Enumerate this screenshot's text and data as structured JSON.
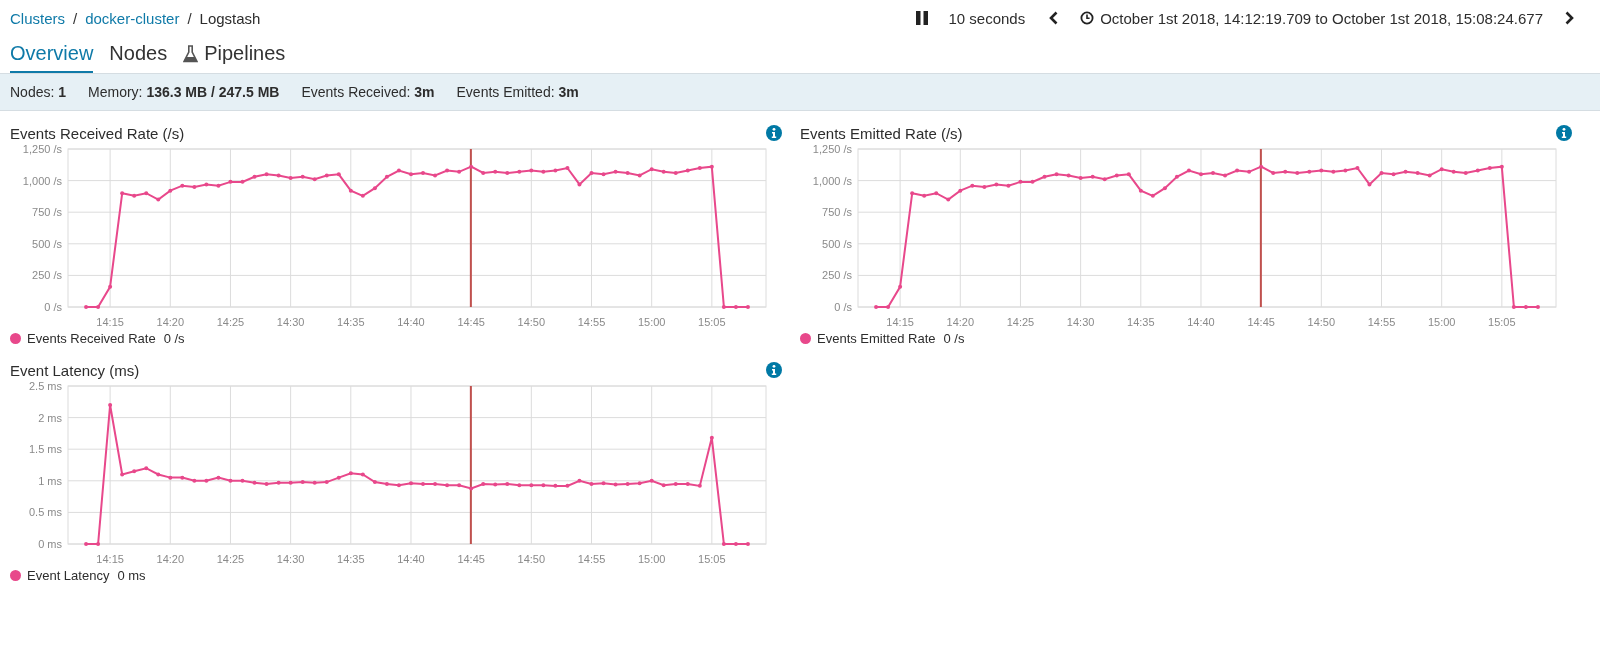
{
  "breadcrumbs": [
    {
      "label": "Clusters",
      "link": true
    },
    {
      "label": "docker-cluster",
      "link": true
    },
    {
      "label": "Logstash",
      "link": false
    }
  ],
  "breadcrumb_separator": "/",
  "time_controls": {
    "interval": "10 seconds",
    "range": "October 1st 2018, 14:12:19.709 to October 1st 2018, 15:08:24.677"
  },
  "tabs": [
    {
      "label": "Overview",
      "selected": true,
      "icon": false
    },
    {
      "label": "Nodes",
      "selected": false,
      "icon": false
    },
    {
      "label": "Pipelines",
      "selected": false,
      "icon": true
    }
  ],
  "stats": [
    "Nodes: **1**",
    "Memory: **136.3 MB / 247.5 MB**",
    "Events Received: **3m**",
    "Events Emitted: **3m**"
  ],
  "charts": [
    {
      "legend_value": "0 /s",
      "chart_data": {
        "type": "line",
        "title": "Events Received Rate (/s)",
        "grid": true,
        "ylim": [
          0,
          1250
        ],
        "yticks": [
          {
            "value": 0,
            "label": "0 /s"
          },
          {
            "value": 250,
            "label": "250 /s"
          },
          {
            "value": 500,
            "label": "500 /s"
          },
          {
            "value": 750,
            "label": "750 /s"
          },
          {
            "value": 1000,
            "label": "1,000 /s"
          },
          {
            "value": 1250,
            "label": "1,250 /s"
          }
        ],
        "categories": [
          null,
          null,
          "14:15",
          null,
          null,
          null,
          null,
          "14:20",
          null,
          null,
          null,
          null,
          "14:25",
          null,
          null,
          null,
          null,
          "14:30",
          null,
          null,
          null,
          null,
          "14:35",
          null,
          null,
          null,
          null,
          "14:40",
          null,
          null,
          null,
          null,
          "14:45",
          null,
          null,
          null,
          null,
          "14:50",
          null,
          null,
          null,
          null,
          "14:55",
          null,
          null,
          null,
          null,
          "15:00",
          null,
          null,
          null,
          null,
          "15:05",
          null,
          null,
          null
        ],
        "series": [
          {
            "name": "Events Received Rate",
            "color": "#e8488b",
            "values": [
              0,
              0,
              160,
              900,
              880,
              900,
              850,
              920,
              960,
              950,
              970,
              960,
              990,
              990,
              1030,
              1050,
              1040,
              1020,
              1030,
              1010,
              1040,
              1050,
              920,
              880,
              940,
              1030,
              1080,
              1050,
              1060,
              1040,
              1080,
              1070,
              1110,
              1060,
              1070,
              1060,
              1070,
              1080,
              1070,
              1080,
              1100,
              970,
              1060,
              1050,
              1070,
              1060,
              1040,
              1090,
              1070,
              1060,
              1080,
              1100,
              1110,
              0,
              0,
              0
            ]
          }
        ],
        "annotations": [
          {
            "x": "14:45"
          }
        ]
      }
    },
    {
      "legend_value": "0 /s",
      "chart_data": {
        "type": "line",
        "title": "Events Emitted Rate (/s)",
        "grid": true,
        "ylim": [
          0,
          1250
        ],
        "yticks": [
          {
            "value": 0,
            "label": "0 /s"
          },
          {
            "value": 250,
            "label": "250 /s"
          },
          {
            "value": 500,
            "label": "500 /s"
          },
          {
            "value": 750,
            "label": "750 /s"
          },
          {
            "value": 1000,
            "label": "1,000 /s"
          },
          {
            "value": 1250,
            "label": "1,250 /s"
          }
        ],
        "categories": [
          null,
          null,
          "14:15",
          null,
          null,
          null,
          null,
          "14:20",
          null,
          null,
          null,
          null,
          "14:25",
          null,
          null,
          null,
          null,
          "14:30",
          null,
          null,
          null,
          null,
          "14:35",
          null,
          null,
          null,
          null,
          "14:40",
          null,
          null,
          null,
          null,
          "14:45",
          null,
          null,
          null,
          null,
          "14:50",
          null,
          null,
          null,
          null,
          "14:55",
          null,
          null,
          null,
          null,
          "15:00",
          null,
          null,
          null,
          null,
          "15:05",
          null,
          null,
          null
        ],
        "series": [
          {
            "name": "Events Emitted Rate",
            "color": "#e8488b",
            "values": [
              0,
              0,
              160,
              900,
              880,
              900,
              850,
              920,
              960,
              950,
              970,
              960,
              990,
              990,
              1030,
              1050,
              1040,
              1020,
              1030,
              1010,
              1040,
              1050,
              920,
              880,
              940,
              1030,
              1080,
              1050,
              1060,
              1040,
              1080,
              1070,
              1110,
              1060,
              1070,
              1060,
              1070,
              1080,
              1070,
              1080,
              1100,
              970,
              1060,
              1050,
              1070,
              1060,
              1040,
              1090,
              1070,
              1060,
              1080,
              1100,
              1110,
              0,
              0,
              0
            ]
          }
        ],
        "annotations": [
          {
            "x": "14:45"
          }
        ]
      }
    },
    {
      "legend_value": "0 ms",
      "chart_data": {
        "type": "line",
        "title": "Event Latency (ms)",
        "grid": true,
        "ylim": [
          0,
          2.5
        ],
        "yticks": [
          {
            "value": 0,
            "label": "0 ms"
          },
          {
            "value": 0.5,
            "label": "0.5 ms"
          },
          {
            "value": 1,
            "label": "1 ms"
          },
          {
            "value": 1.5,
            "label": "1.5 ms"
          },
          {
            "value": 2,
            "label": "2 ms"
          },
          {
            "value": 2.5,
            "label": "2.5 ms"
          }
        ],
        "categories": [
          null,
          null,
          "14:15",
          null,
          null,
          null,
          null,
          "14:20",
          null,
          null,
          null,
          null,
          "14:25",
          null,
          null,
          null,
          null,
          "14:30",
          null,
          null,
          null,
          null,
          "14:35",
          null,
          null,
          null,
          null,
          "14:40",
          null,
          null,
          null,
          null,
          "14:45",
          null,
          null,
          null,
          null,
          "14:50",
          null,
          null,
          null,
          null,
          "14:55",
          null,
          null,
          null,
          null,
          "15:00",
          null,
          null,
          null,
          null,
          "15:05",
          null,
          null,
          null
        ],
        "series": [
          {
            "name": "Event Latency",
            "color": "#e8488b",
            "values": [
              0,
              0,
              2.2,
              1.1,
              1.15,
              1.2,
              1.1,
              1.05,
              1.05,
              1.0,
              1.0,
              1.05,
              1.0,
              1.0,
              0.97,
              0.95,
              0.97,
              0.97,
              0.98,
              0.97,
              0.98,
              1.05,
              1.12,
              1.1,
              0.98,
              0.95,
              0.93,
              0.96,
              0.95,
              0.95,
              0.93,
              0.93,
              0.88,
              0.95,
              0.94,
              0.95,
              0.93,
              0.93,
              0.93,
              0.92,
              0.92,
              1.0,
              0.95,
              0.96,
              0.94,
              0.95,
              0.96,
              1.0,
              0.93,
              0.95,
              0.95,
              0.92,
              1.68,
              0,
              0,
              0
            ]
          }
        ],
        "annotations": [
          {
            "x": "14:45"
          }
        ]
      }
    }
  ]
}
